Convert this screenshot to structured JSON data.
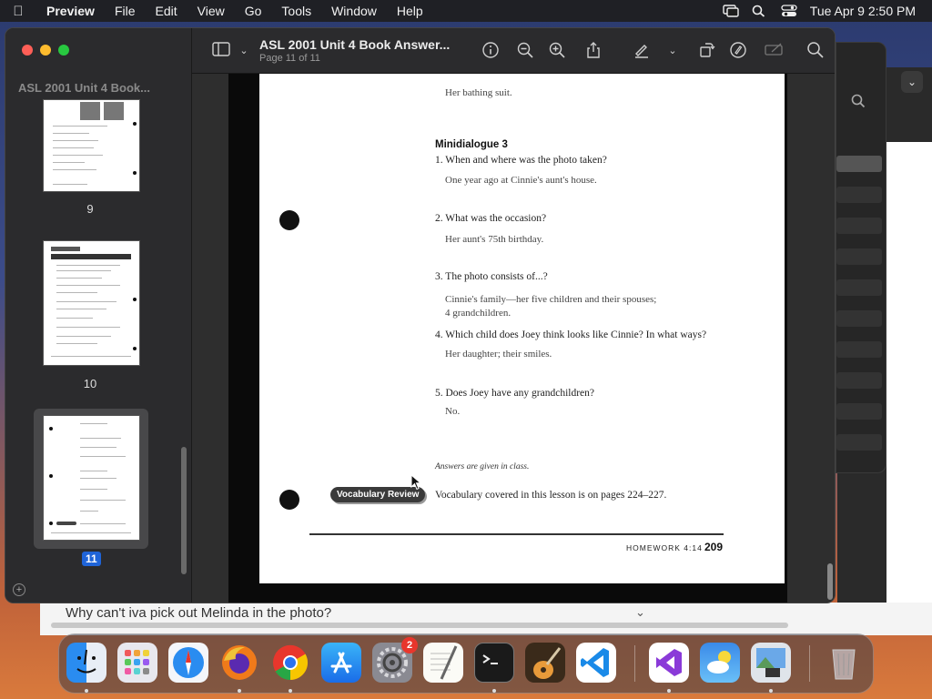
{
  "menubar": {
    "app_name": "Preview",
    "items": [
      "File",
      "Edit",
      "View",
      "Go",
      "Tools",
      "Window",
      "Help"
    ],
    "clock": "Tue Apr 9  2:50 PM"
  },
  "window": {
    "title": "ASL 2001 Unit 4 Book Answer...",
    "subtitle": "Page 11 of 11"
  },
  "sidebar": {
    "doc_title": "ASL 2001 Unit 4 Book...",
    "thumbnails": [
      {
        "label": "9"
      },
      {
        "label": "10"
      },
      {
        "label": "11",
        "selected": true
      }
    ]
  },
  "page": {
    "top_answer": "Her bathing suit.",
    "section_title": "Minidialogue 3",
    "items": [
      {
        "q": "1. When and where was the photo taken?",
        "a": "One year ago at Cinnie's aunt's house."
      },
      {
        "q": "2. What was the occasion?",
        "a": "Her aunt's 75th birthday."
      },
      {
        "q": "3. The photo consists of...?",
        "a": "Cinnie's family—her five children and their spouses;",
        "a2": "4 grandchildren."
      },
      {
        "q": "4. Which child does Joey think looks like Cinnie?  In what ways?",
        "a": "Her daughter; their smiles."
      },
      {
        "q": "5. Does Joey have any grandchildren?",
        "a": "No."
      }
    ],
    "note": "Answers are given in class.",
    "vocab_badge": "Vocabulary Review",
    "vocab_text": "Vocabulary covered in this lesson is on pages 224–227.",
    "footer_label": "HOMEWORK 4:14",
    "footer_page": "209"
  },
  "browser_strip": {
    "question": "Why can't iva pick out Melinda in the photo?"
  },
  "dock": {
    "apps": [
      "finder-icon",
      "launchpad-icon",
      "safari-icon",
      "firefox-icon",
      "chrome-icon",
      "app-store-icon",
      "system-settings-icon",
      "textedit-icon",
      "terminal-icon",
      "garageband-icon",
      "vscode-icon",
      "visual-studio-icon",
      "weather-icon",
      "preview-icon",
      "trash-icon"
    ],
    "settings_badge": "2"
  },
  "colors": {
    "accent": "#1f64d8",
    "close": "#ff5f57",
    "minimize": "#febc2e",
    "zoom": "#28c840"
  }
}
